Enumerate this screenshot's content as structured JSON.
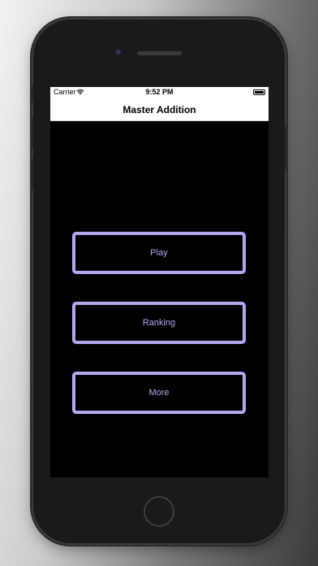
{
  "status_bar": {
    "carrier": "Carrier",
    "time": "9:52 PM"
  },
  "nav": {
    "title": "Master Addition"
  },
  "menu": {
    "play_label": "Play",
    "ranking_label": "Ranking",
    "more_label": "More"
  },
  "icons": {
    "wifi": "wifi-icon",
    "battery": "battery-icon"
  },
  "colors": {
    "accent": "#b3a8f0",
    "screen_background": "#000000"
  }
}
